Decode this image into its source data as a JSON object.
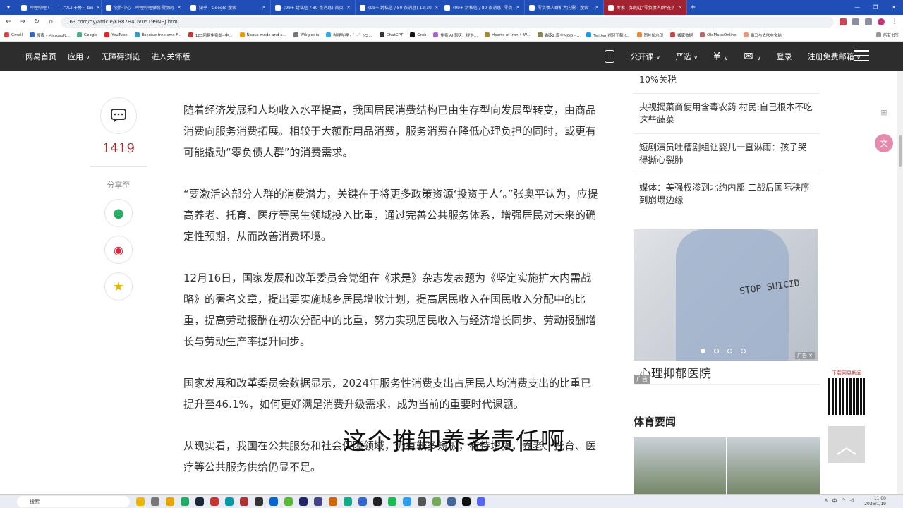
{
  "browser": {
    "tabs": [
      {
        "title": "哔哩哔哩 ( ゜- ゜)つロ 干杯~-bili"
      },
      {
        "title": "创作中心 - 哔哩哔哩弹幕视频网"
      },
      {
        "title": "知乎 - Google 搜索"
      },
      {
        "title": "(99+ 封私信 / 80 条消息) 首页"
      },
      {
        "title": "(99+ 封私信 / 80 条消息) 12:30"
      },
      {
        "title": "(99+ 封私信 / 80 条消息) 零负"
      },
      {
        "title": "零负债人群扩大内需 - 搜索"
      },
      {
        "title": "专家：如何让\"零负债人群\"在扩"
      }
    ],
    "url": "163.com/dy/article/KH87H4DV05199NHJ.html",
    "bookmarks": [
      "Gmail",
      "搜索 - Microsoft...",
      "Google",
      "YouTube",
      "Receive free sms F...",
      "163网易免费邮--中...",
      "Nexus mods and c...",
      "Wikipedia",
      "哔哩哔哩 ( ゜- ゜)つ...",
      "ChatGPT",
      "Grok",
      "免费 AI 聊天、提供...",
      "Hearts of Iron 4 W...",
      "猫砖2:霸主MOD -...",
      "Twitter 视频下载 (...",
      "图片加水印",
      "搬家数据",
      "OldMapsOnline",
      "猫马与依依中文站"
    ],
    "all_bookmarks": "所有书签"
  },
  "nav": {
    "left": [
      "网易首页",
      "应用",
      "无障碍浏览",
      "进入关怀版"
    ],
    "right": [
      "公开课",
      "严选",
      "登录",
      "注册免费邮箱"
    ]
  },
  "share": {
    "comment_count": "1419",
    "label": "分享至"
  },
  "article": {
    "paragraphs": [
      "随着经济发展和人均收入水平提高，我国居民消费结构已由生存型向发展型转变，由商品消费向服务消费拓展。相较于大额耐用品消费，服务消费在降低心理负担的同时，或更有可能撬动“零负债人群”的消费需求。",
      "“要激活这部分人群的消费潜力，关键在于将更多政策资源‘投资于人’。”张奥平认为，应提高养老、托育、医疗等民生领域投入比重，通过完善公共服务体系，增强居民对未来的确定性预期，从而改善消费环境。",
      "12月16日，国家发展和改革委员会党组在《求是》杂志发表题为《坚定实施扩大内需战略》的署名文章，提出要实施城乡居民增收计划，提高居民收入在国民收入分配中的比重，提高劳动报酬在初次分配中的比重，努力实现居民收入与经济增长同步、劳动报酬增长与劳动生产率提升同步。",
      "国家发展和改革委员会数据显示，2024年服务性消费支出占居民人均消费支出的比重已提升至46.1%，如何更好满足消费升级需求，成为当前的重要时代课题。",
      "从现实看，我国在公共服务和社会保障领域，仍有较多短板，有待增强，养老、托育、医疗等公共服务供给仍显不足。"
    ]
  },
  "sidebar": {
    "news": [
      "10%关税",
      "央视揭菜商使用含毒农药 村民:自己根本不吃这些蔬菜",
      "短剧演员吐槽剧组让婴儿一直淋雨：孩子哭得撕心裂肺",
      "媒体：美强权渗到北约内部 二战后国际秩序到崩塌边缘"
    ],
    "ad": {
      "sign_text": "STOP SUICID",
      "caption": "心理抑郁医院",
      "badge": "广告",
      "corner": "广告"
    },
    "sport_title": "体育要闻"
  },
  "floating": {
    "qr_label": "下载网易新闻",
    "top_arrow": "︿"
  },
  "subtitle": "这个推卸养老责任啊",
  "taskbar": {
    "search": "搜索",
    "lang": "中",
    "time": "11:00",
    "date": "2026/1/19"
  }
}
